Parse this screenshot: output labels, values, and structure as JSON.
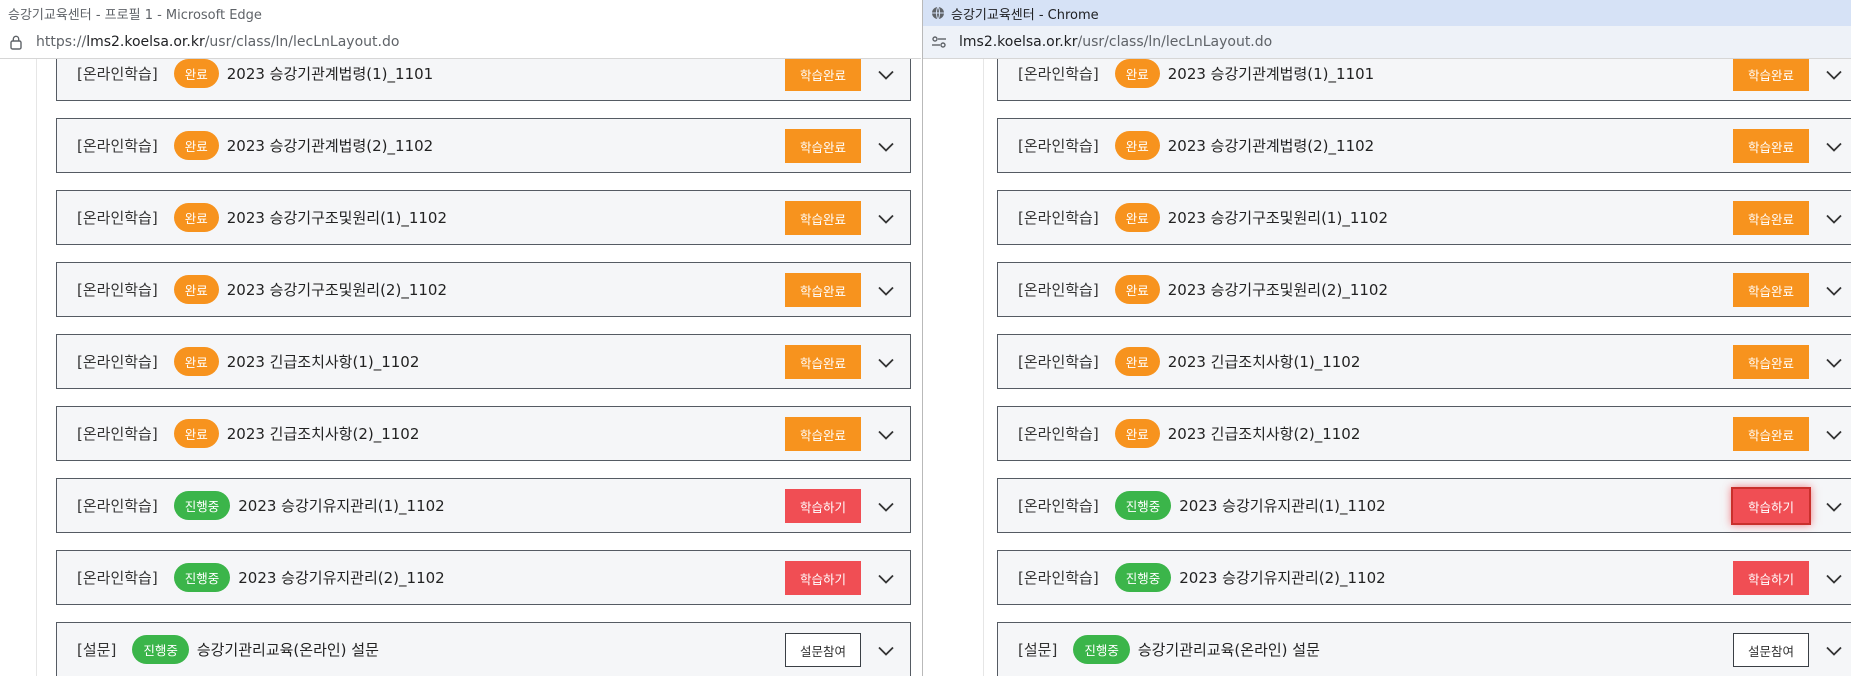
{
  "left_window": {
    "title": "승강기교육센터 - 프로필 1 - Microsoft Edge",
    "url_prefix": "https://",
    "url_host": "lms2.koelsa.or.kr",
    "url_path": "/usr/class/ln/lecLnLayout.do"
  },
  "right_window": {
    "title": "승강기교육센터 - Chrome",
    "url_host": "lms2.koelsa.or.kr",
    "url_path": "/usr/class/ln/lecLnLayout.do"
  },
  "courses": [
    {
      "category": "[온라인학습]",
      "badge": "완료",
      "title": "2023 승강기관계법령(1)_1101",
      "button": "학습완료"
    },
    {
      "category": "[온라인학습]",
      "badge": "완료",
      "title": "2023 승강기관계법령(2)_1102",
      "button": "학습완료"
    },
    {
      "category": "[온라인학습]",
      "badge": "완료",
      "title": "2023 승강기구조및원리(1)_1102",
      "button": "학습완료"
    },
    {
      "category": "[온라인학습]",
      "badge": "완료",
      "title": "2023 승강기구조및원리(2)_1102",
      "button": "학습완료"
    },
    {
      "category": "[온라인학습]",
      "badge": "완료",
      "title": "2023 긴급조치사항(1)_1102",
      "button": "학습완료"
    },
    {
      "category": "[온라인학습]",
      "badge": "완료",
      "title": "2023 긴급조치사항(2)_1102",
      "button": "학습완료"
    },
    {
      "category": "[온라인학습]",
      "badge": "진행중",
      "title": "2023 승강기유지관리(1)_1102",
      "button": "학습하기"
    },
    {
      "category": "[온라인학습]",
      "badge": "진행중",
      "title": "2023 승강기유지관리(2)_1102",
      "button": "학습하기"
    },
    {
      "category": "[설문]",
      "badge": "진행중",
      "title": "승강기관리교육(온라인) 설문",
      "button": "설문참여"
    }
  ],
  "colors": {
    "badge_done": "#f7931e",
    "badge_progress": "#3bb54a",
    "button_study": "#f04e54",
    "row_bg": "#f5f6f8"
  },
  "icons": [
    "lock-icon",
    "site-settings-icon",
    "globe-icon",
    "chevron-down-icon"
  ]
}
